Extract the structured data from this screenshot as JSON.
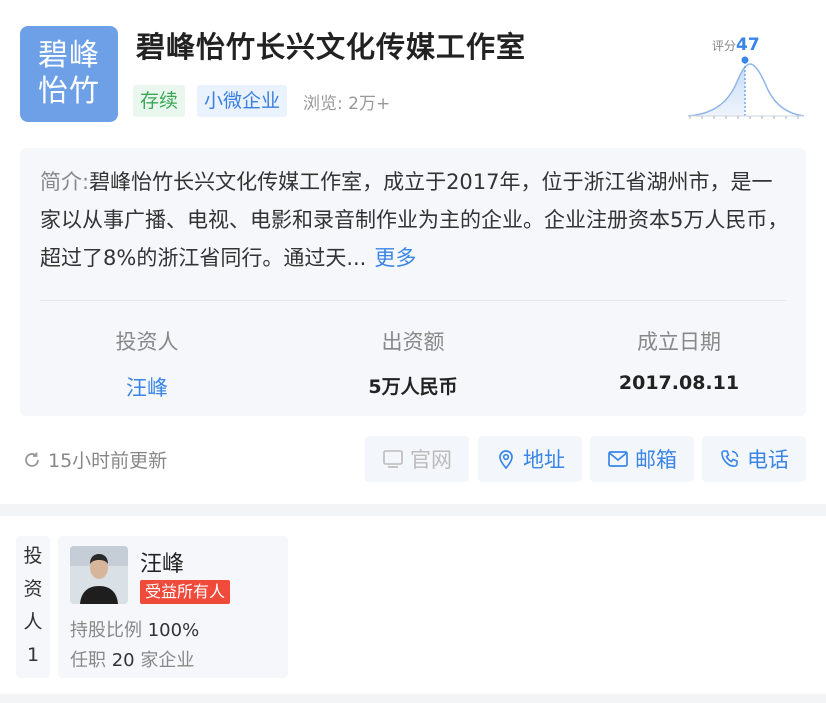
{
  "company": {
    "logo_line1": "碧峰",
    "logo_line2": "怡竹",
    "name": "碧峰怡竹长兴文化传媒工作室",
    "tag_status": "存续",
    "tag_size": "小微企业",
    "views": "浏览: 2万+"
  },
  "score": {
    "label": "评分",
    "value": "47"
  },
  "intro": {
    "prefix": "简介:",
    "text": "碧峰怡竹长兴文化传媒工作室，成立于2017年，位于浙江省湖州市，是一家以从事广播、电视、电影和录音制作业为主的企业。企业注册资本5万人民币，超过了8%的浙江省同行。通过天...",
    "more": "更多"
  },
  "stats": [
    {
      "key": "投资人",
      "value": "汪峰"
    },
    {
      "key": "出资额",
      "value": "5万人民币"
    },
    {
      "key": "成立日期",
      "value": "2017.08.11"
    }
  ],
  "updated": "15小时前更新",
  "actions": {
    "website": "官网",
    "address": "地址",
    "email": "邮箱",
    "phone": "电话"
  },
  "investor_section": {
    "side_label": [
      "投",
      "资",
      "人",
      "1"
    ],
    "name": "汪峰",
    "badge": "受益所有人",
    "share_label": "持股比例",
    "share_value": "100%",
    "post_label": "任职",
    "post_value": "20",
    "post_suffix": "家企业"
  },
  "colors": {
    "accent": "#3a86e8",
    "logo_bg": "#6ea0e8",
    "status_green": "#3aa957",
    "badge_red": "#f04a3a"
  }
}
